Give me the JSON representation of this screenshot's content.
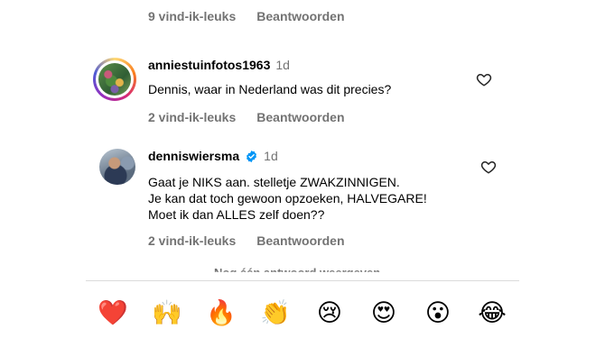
{
  "top_meta": {
    "likes": "9 vind-ik-leuks",
    "reply": "Beantwoorden"
  },
  "comments": [
    {
      "username": "anniestuinfotos1963",
      "time": "1d",
      "text": "Dennis, waar in Nederland was dit precies?",
      "likes": "2 vind-ik-leuks",
      "reply": "Beantwoorden"
    },
    {
      "username": "denniswiersma",
      "verified": true,
      "time": "1d",
      "lines": [
        "Gaat je NIKS aan. stelletje ZWAKZINNIGEN.",
        "Je kan dat toch gewoon opzoeken, HALVEGARE!",
        "Moet ik dan ALLES zelf doen??"
      ],
      "likes": "2 vind-ik-leuks",
      "reply": "Beantwoorden"
    }
  ],
  "more_replies": "Nog één antwoord weergeven",
  "emoji_bar": [
    "❤️",
    "🙌",
    "🔥",
    "👏",
    "😢",
    "😍",
    "😮",
    "😂"
  ],
  "colors": {
    "meta": "#737373",
    "verified": "#0095f6",
    "divider": "#dbdbdb"
  }
}
